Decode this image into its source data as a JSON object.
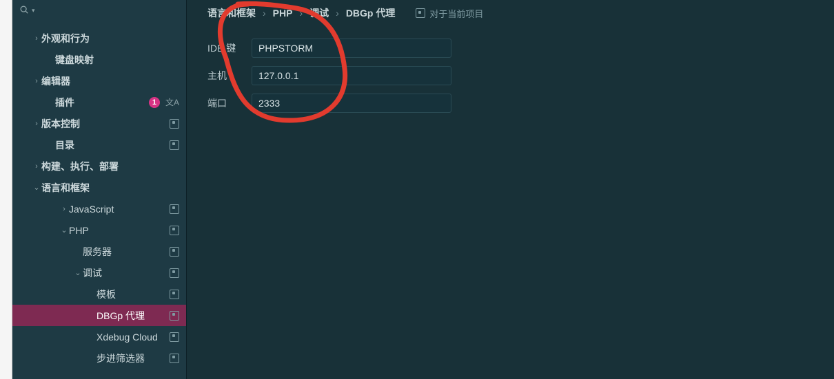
{
  "breadcrumb": {
    "crumb1": "语言和框架",
    "crumb2": "PHP",
    "crumb3": "调试",
    "crumb4": "DBGp 代理",
    "scope_label": "对于当前项目"
  },
  "sidebar": {
    "items": [
      {
        "label": "外观和行为",
        "arrow": "right",
        "indent": 1,
        "proj": false,
        "bold": true
      },
      {
        "label": "键盘映射",
        "arrow": "",
        "indent": 2,
        "proj": false,
        "bold": true
      },
      {
        "label": "编辑器",
        "arrow": "right",
        "indent": 1,
        "proj": false,
        "bold": true
      },
      {
        "label": "插件",
        "arrow": "",
        "indent": 2,
        "proj": false,
        "bold": true,
        "badge": "1",
        "xa": true
      },
      {
        "label": "版本控制",
        "arrow": "right",
        "indent": 1,
        "proj": true,
        "bold": true
      },
      {
        "label": "目录",
        "arrow": "",
        "indent": 2,
        "proj": true,
        "bold": true
      },
      {
        "label": "构建、执行、部署",
        "arrow": "right",
        "indent": 1,
        "proj": false,
        "bold": true
      },
      {
        "label": "语言和框架",
        "arrow": "down",
        "indent": 1,
        "proj": false,
        "bold": true
      },
      {
        "label": "JavaScript",
        "arrow": "right",
        "indent": 3,
        "proj": true,
        "bold": false
      },
      {
        "label": "PHP",
        "arrow": "down",
        "indent": 3,
        "proj": true,
        "bold": false
      },
      {
        "label": "服务器",
        "arrow": "",
        "indent": 4,
        "proj": true,
        "bold": false
      },
      {
        "label": "调试",
        "arrow": "down",
        "indent": 4,
        "proj": true,
        "bold": false
      },
      {
        "label": "模板",
        "arrow": "",
        "indent": 5,
        "proj": true,
        "bold": false
      },
      {
        "label": "DBGp 代理",
        "arrow": "",
        "indent": 5,
        "proj": true,
        "bold": false,
        "selected": true
      },
      {
        "label": "Xdebug Cloud",
        "arrow": "",
        "indent": 5,
        "proj": true,
        "bold": false
      },
      {
        "label": "步进筛选器",
        "arrow": "",
        "indent": 5,
        "proj": true,
        "bold": false
      }
    ]
  },
  "form": {
    "ide_key_label": "IDE 键",
    "ide_key_value": "PHPSTORM",
    "host_label": "主机",
    "host_value": "127.0.0.1",
    "port_label": "端口",
    "port_value": "2333"
  },
  "annotation_color": "#e23b2e"
}
